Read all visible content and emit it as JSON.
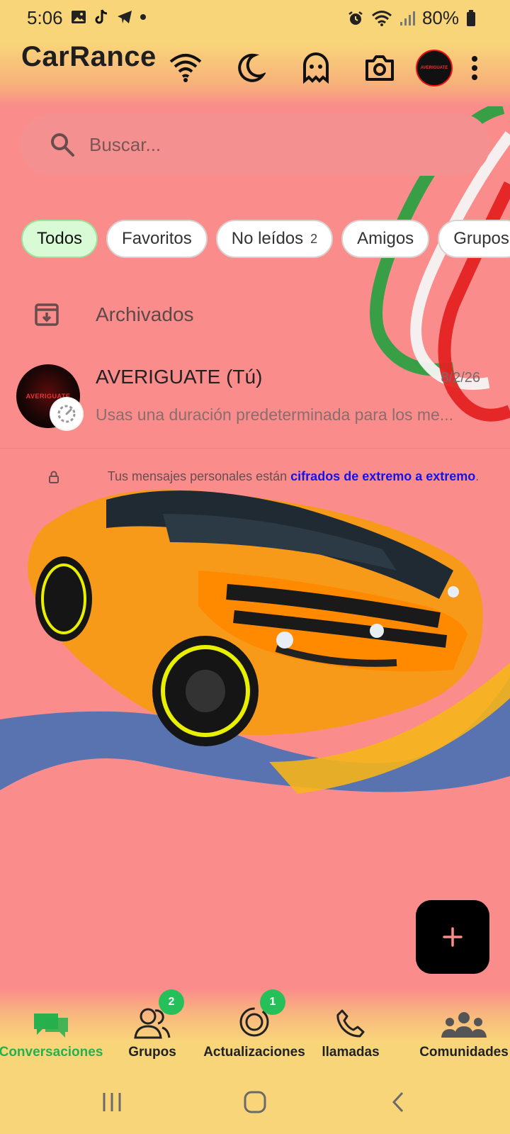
{
  "status_bar": {
    "time": "5:06",
    "battery": "80%"
  },
  "app": {
    "title": "CarRance"
  },
  "search": {
    "placeholder": "Buscar..."
  },
  "chips": [
    {
      "label": "Todos",
      "active": true
    },
    {
      "label": "Favoritos"
    },
    {
      "label": "No leídos",
      "count": "2"
    },
    {
      "label": "Amigos"
    },
    {
      "label": "Grupos"
    }
  ],
  "archived": {
    "label": "Archivados"
  },
  "chat": {
    "name": "AVERIGUATE (Tú)",
    "date": "8/2/26",
    "preview": "Usas una duración predeterminada para los me...",
    "avatar_text": "AVERIGUATE"
  },
  "encryption": {
    "text": "Tus mensajes personales están ",
    "link": "cifrados de extremo a extremo",
    "end": "."
  },
  "bottom_nav": [
    {
      "label": "Conversaciones",
      "icon": "chat-bubbles-icon",
      "active": true
    },
    {
      "label": "Grupos",
      "icon": "group-icon",
      "badge": "2"
    },
    {
      "label": "Actualizaciones",
      "icon": "status-icon",
      "badge": "1"
    },
    {
      "label": "llamadas",
      "icon": "phone-icon"
    },
    {
      "label": "Comunidades",
      "icon": "communities-icon"
    }
  ],
  "colors": {
    "accent_green": "#27b04e",
    "badge_green": "#25c05a",
    "background": "#fb8c8c",
    "link": "#1414e6"
  }
}
